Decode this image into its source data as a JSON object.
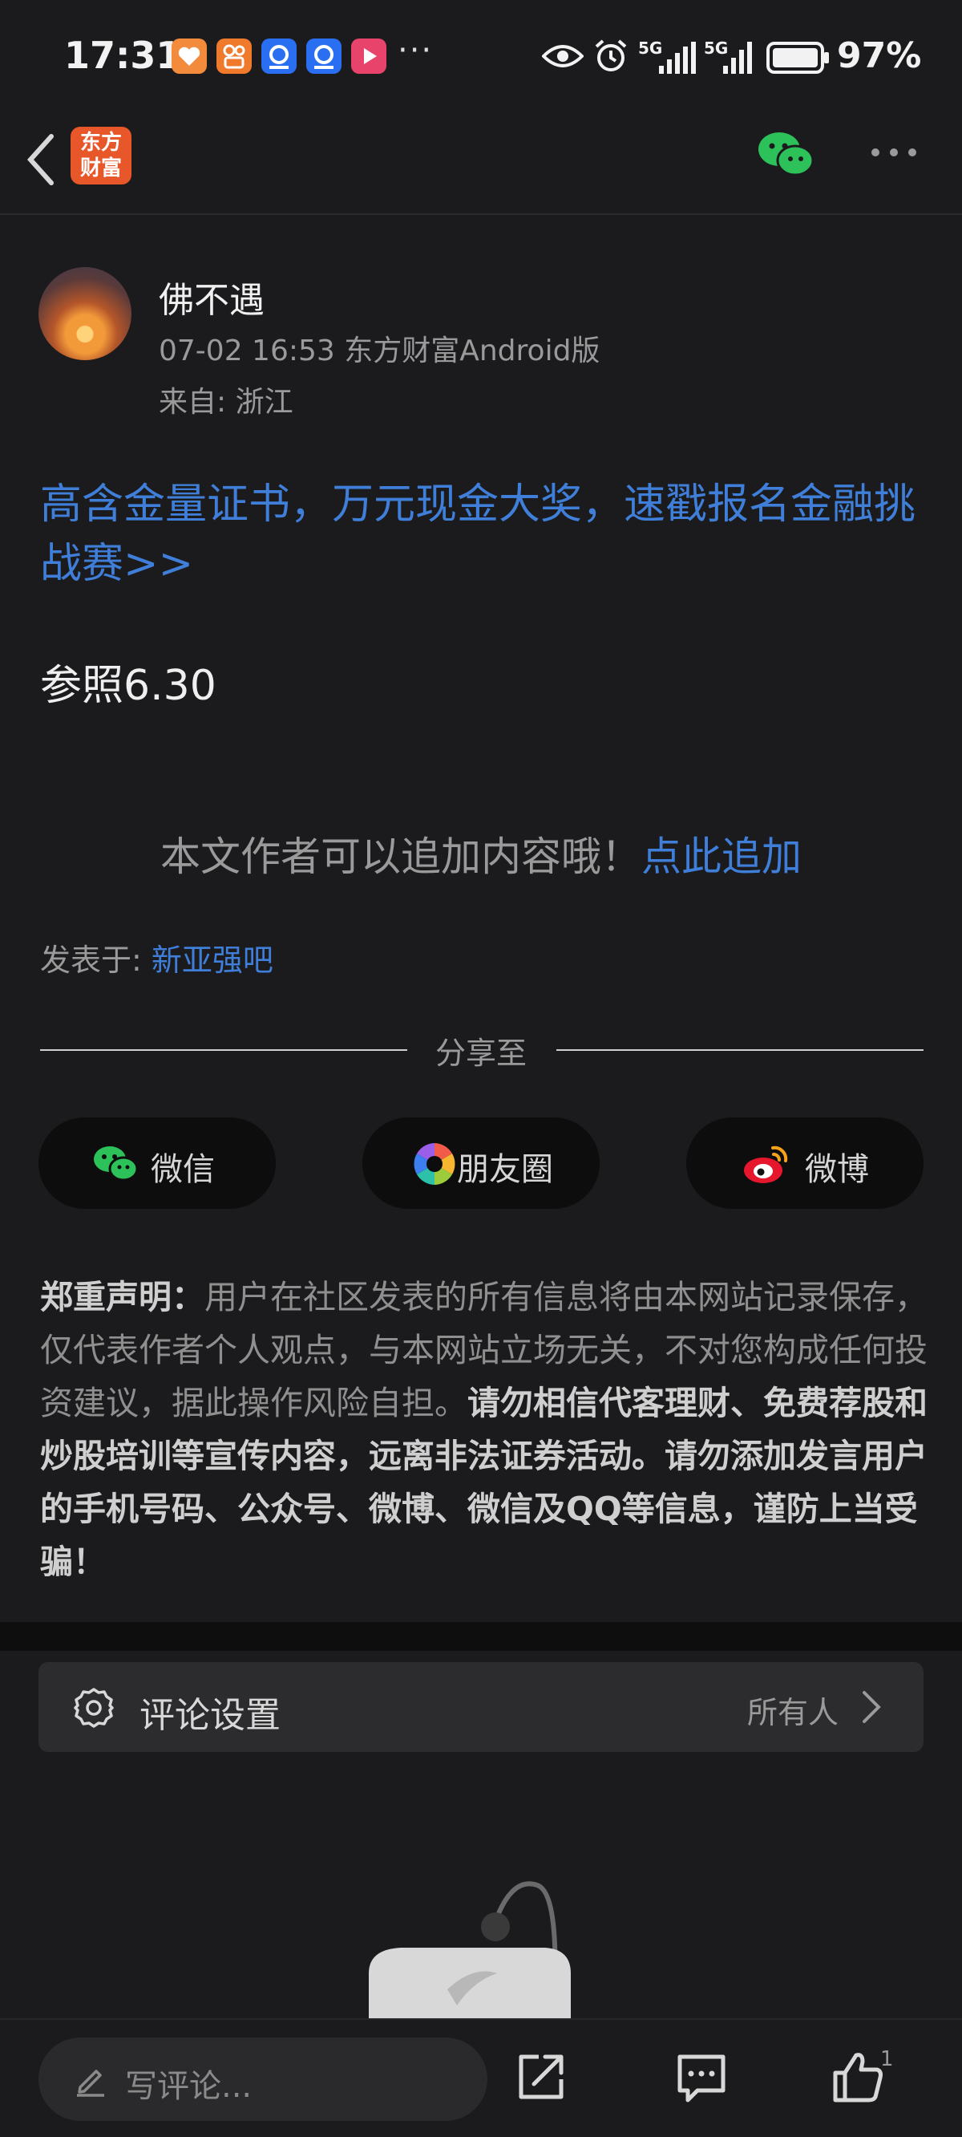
{
  "status_bar": {
    "time": "17:31",
    "more": "···",
    "network_1": "5G",
    "network_2": "5G",
    "battery_percent": "97%",
    "apps": [
      "heart-app-icon",
      "kuaishou-app-icon",
      "browser-app-icon",
      "browser-app-icon",
      "video-app-icon"
    ]
  },
  "nav": {
    "logo_text_line1": "东方",
    "logo_text_line2": "财富",
    "icons": [
      "back-icon",
      "wechat-icon",
      "more-icon"
    ]
  },
  "post": {
    "author": "佛不遇",
    "meta_line": "07-02 16:53 东方财富Android版",
    "location": "来自: 浙江",
    "promo": "高含金量证书，万元现金大奖，速戳报名金融挑战赛>>",
    "body": "参照6.30",
    "append_text": "本文作者可以追加内容哦！",
    "append_link": "点此追加",
    "posted_in_label": "发表于: ",
    "posted_in_link": "新亚强吧"
  },
  "share": {
    "title": "分享至",
    "buttons": [
      {
        "label": "微信",
        "icon": "wechat-icon"
      },
      {
        "label": "朋友圈",
        "icon": "moments-icon"
      },
      {
        "label": "微博",
        "icon": "weibo-icon"
      }
    ]
  },
  "disclaimer": {
    "title": "郑重声明",
    "colon": "：",
    "normal": "用户在社区发表的所有信息将由本网站记录保存，仅代表作者个人观点，与本网站立场无关，不对您构成任何投资建议，据此操作风险自担。",
    "bold": "请勿相信代客理财、免费荐股和炒股培训等宣传内容，远离非法证券活动。请勿添加发言用户的手机号码、公众号、微博、微信及QQ等信息，谨防上当受骗！"
  },
  "comment_settings": {
    "label": "评论设置",
    "value": "所有人"
  },
  "bottom_bar": {
    "placeholder": "写评论...",
    "like_count": "1"
  },
  "colors": {
    "background": "#1b1b1d",
    "link": "#3f7fd9",
    "logo": "#e8572a",
    "wechat_green": "#2dc15a"
  }
}
